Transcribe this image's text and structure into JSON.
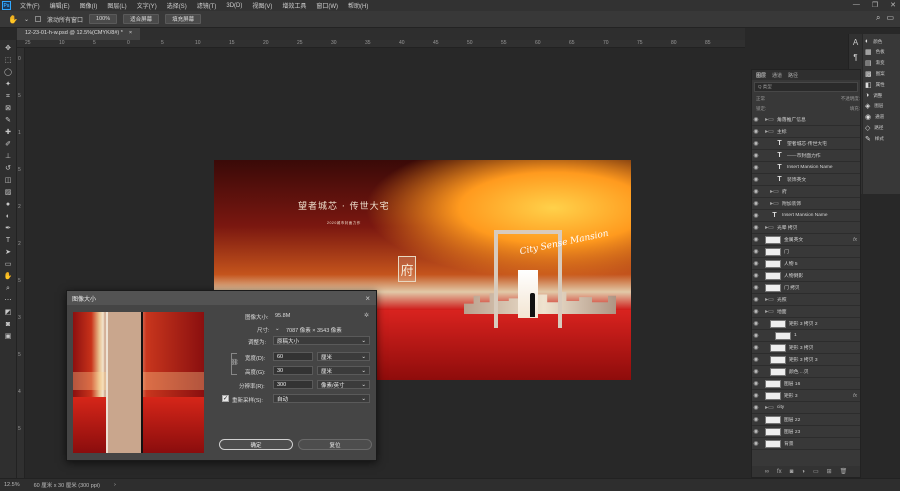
{
  "menu": {
    "logo": "Ps",
    "items": [
      "文件(F)",
      "编辑(E)",
      "图像(I)",
      "图层(L)",
      "文字(Y)",
      "选择(S)",
      "滤镜(T)",
      "3D(D)",
      "视图(V)",
      "增效工具",
      "窗口(W)",
      "帮助(H)"
    ]
  },
  "options": {
    "scroll_all_label": "滚动所有窗口",
    "zoom_value": "100%",
    "fit_screen_label": "适合屏幕",
    "fill_screen_label": "填充屏幕"
  },
  "document_tab": {
    "title": "12-23-01-h-w.psd @ 12.5%(CMYK/8#) *",
    "close": "×"
  },
  "ruler": {
    "h_ticks": [
      "25",
      "10",
      "5",
      "0",
      "5",
      "10",
      "15",
      "20",
      "25",
      "30",
      "35",
      "40",
      "45",
      "50",
      "55",
      "60",
      "65",
      "70",
      "75",
      "80",
      "85"
    ],
    "v_ticks": [
      "0",
      "5",
      "1",
      "5",
      "2",
      "2",
      "5",
      "3",
      "5",
      "4",
      "5"
    ]
  },
  "artwork": {
    "headline": "望者城芯 · 传世大宅",
    "subline": "2020城市封面力作",
    "seal_char": "府",
    "script_text": "City Sense Mansion"
  },
  "dialog": {
    "title": "图像大小",
    "close": "×",
    "image_size_label": "图像大小:",
    "image_size_value": "95.8M",
    "dimensions_label": "尺寸:",
    "dimensions_value": "7087 像素 × 3543 像素",
    "fit_to_label": "调整为:",
    "fit_to_value": "原稿大小",
    "width_label": "宽度(D):",
    "width_value": "60",
    "width_unit": "厘米",
    "height_label": "高度(G):",
    "height_value": "30",
    "height_unit": "厘米",
    "resolution_label": "分辨率(R):",
    "resolution_value": "300",
    "resolution_unit": "像素/英寸",
    "resample_label": "重新采样(S):",
    "resample_value": "自动",
    "ok_label": "确定",
    "reset_label": "复位"
  },
  "layers_panel": {
    "tabs": [
      "图层",
      "通道",
      "路径"
    ],
    "search_placeholder": "Q 类型",
    "blend_mode": "正常",
    "opacity_label": "不透明度:",
    "lock_label": "锁定:",
    "fill_label": "填充:",
    "rows": [
      {
        "type": "folder",
        "name": "角落推广信息",
        "fx": ""
      },
      {
        "type": "folder",
        "name": "主标",
        "fx": ""
      },
      {
        "type": "text",
        "name": "望者城芯·传世大宅",
        "fx": ""
      },
      {
        "type": "text",
        "name": "——市封面力作",
        "fx": ""
      },
      {
        "type": "text",
        "name": "Insert Mansion Name",
        "fx": ""
      },
      {
        "type": "text",
        "name": "装饰英文",
        "fx": ""
      },
      {
        "type": "folder",
        "name": "府",
        "fx": ""
      },
      {
        "type": "folder",
        "name": "附加装饰",
        "fx": ""
      },
      {
        "type": "text",
        "name": "Insert Mansion Name",
        "fx": ""
      },
      {
        "type": "folder",
        "name": "光晕 拷贝",
        "fx": ""
      },
      {
        "type": "layer",
        "name": "金属英文",
        "fx": "fx"
      },
      {
        "type": "layer",
        "name": "门",
        "fx": ""
      },
      {
        "type": "layer",
        "name": "人物 5",
        "fx": ""
      },
      {
        "type": "layer",
        "name": "人物倒影",
        "fx": ""
      },
      {
        "type": "layer",
        "name": "门 拷贝",
        "fx": ""
      },
      {
        "type": "folder",
        "name": "光照",
        "fx": ""
      },
      {
        "type": "folder",
        "name": "地面",
        "fx": ""
      },
      {
        "type": "layer",
        "name": "矩形 3 拷贝 2",
        "fx": ""
      },
      {
        "type": "layer",
        "name": "1",
        "fx": ""
      },
      {
        "type": "layer",
        "name": "矩形 3 拷贝",
        "fx": ""
      },
      {
        "type": "layer",
        "name": "矩形 3 拷贝 3",
        "fx": ""
      },
      {
        "type": "layer",
        "name": "颜色 ...贝",
        "fx": ""
      },
      {
        "type": "layer",
        "name": "图层 16",
        "fx": ""
      },
      {
        "type": "layer",
        "name": "矩形 3",
        "fx": "fx"
      },
      {
        "type": "folder",
        "name": "city",
        "fx": ""
      },
      {
        "type": "layer",
        "name": "图层 22",
        "fx": ""
      },
      {
        "type": "layer",
        "name": "图层 23",
        "fx": ""
      },
      {
        "type": "layer",
        "name": "背景",
        "fx": ""
      }
    ]
  },
  "right_panels": {
    "items": [
      {
        "icon": "◐",
        "label": "颜色"
      },
      {
        "icon": "▦",
        "label": "色板"
      },
      {
        "icon": "▤",
        "label": "渐变"
      },
      {
        "icon": "▩",
        "label": "图案"
      },
      {
        "icon": "◧",
        "label": "属性"
      },
      {
        "icon": "◑",
        "label": "调整"
      },
      {
        "icon": "◈",
        "label": "图层"
      },
      {
        "icon": "◉",
        "label": "通道"
      },
      {
        "icon": "◇",
        "label": "路径"
      },
      {
        "icon": "✎",
        "label": "样式"
      }
    ]
  },
  "status": {
    "zoom": "12.5%",
    "doc_size": "60 厘米 x 30 厘米 (300 ppi)"
  },
  "colors": {
    "accent": "#31a8ff",
    "app_bg": "#282828",
    "panel_bg": "#383838"
  }
}
